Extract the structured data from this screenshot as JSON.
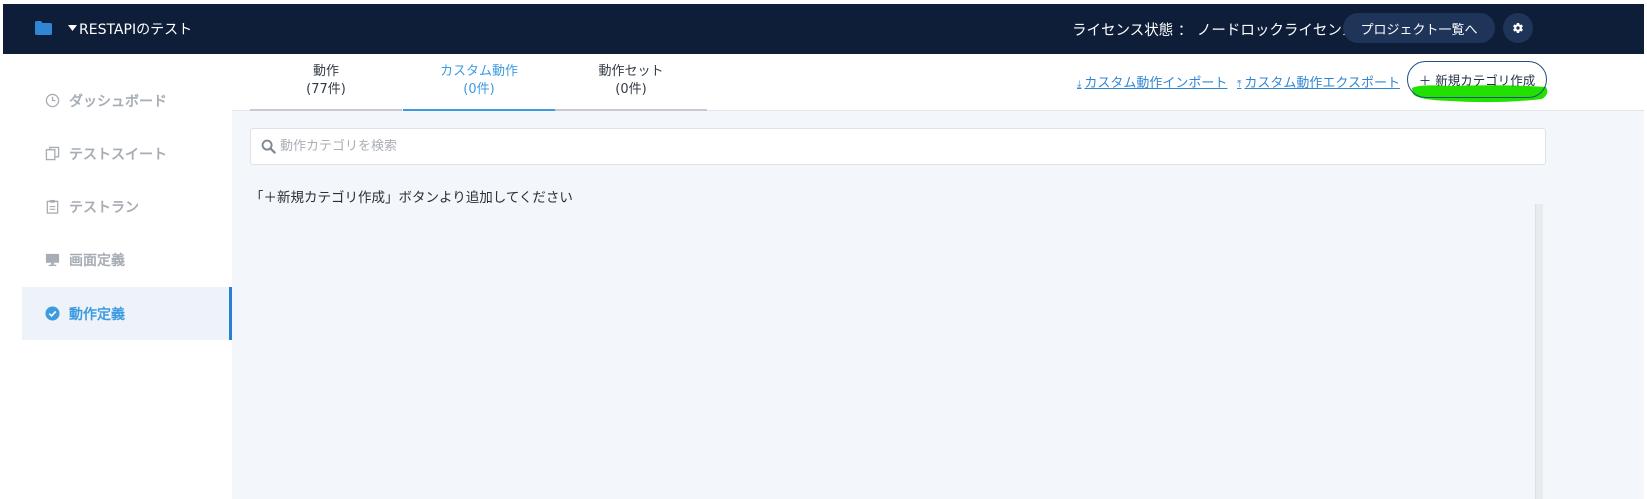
{
  "header": {
    "project_name": "RESTAPIのテスト",
    "license_text": "ライセンス状態 ： ノードロックライセンス",
    "project_list_button": "プロジェクト一覧へ",
    "settings_icon": "gear-icon"
  },
  "sidebar": {
    "items": [
      {
        "label": "ダッシュボード",
        "icon": "clock-icon",
        "active": false
      },
      {
        "label": "テストスイート",
        "icon": "copy-icon",
        "active": false
      },
      {
        "label": "テストラン",
        "icon": "clipboard-icon",
        "active": false
      },
      {
        "label": "画面定義",
        "icon": "monitor-icon",
        "active": false
      },
      {
        "label": "動作定義",
        "icon": "check-circle-icon",
        "active": true
      }
    ]
  },
  "tabs": [
    {
      "label": "動作",
      "count": "(77件)",
      "active": false
    },
    {
      "label": "カスタム動作",
      "count": "(0件)",
      "active": true
    },
    {
      "label": "動作セット",
      "count": "(0件)",
      "active": false
    }
  ],
  "actions": {
    "import_label": "カスタム動作インポート",
    "export_label": "カスタム動作エクスポート",
    "new_category_label": "＋ 新規カテゴリ作成"
  },
  "search": {
    "placeholder": "動作カテゴリを検索",
    "value": ""
  },
  "empty_message": "「＋新規カテゴリ作成」ボタンより追加してください",
  "colors": {
    "header_bg": "#0e1d38",
    "accent": "#3d9be0",
    "highlight": "#22e000"
  }
}
